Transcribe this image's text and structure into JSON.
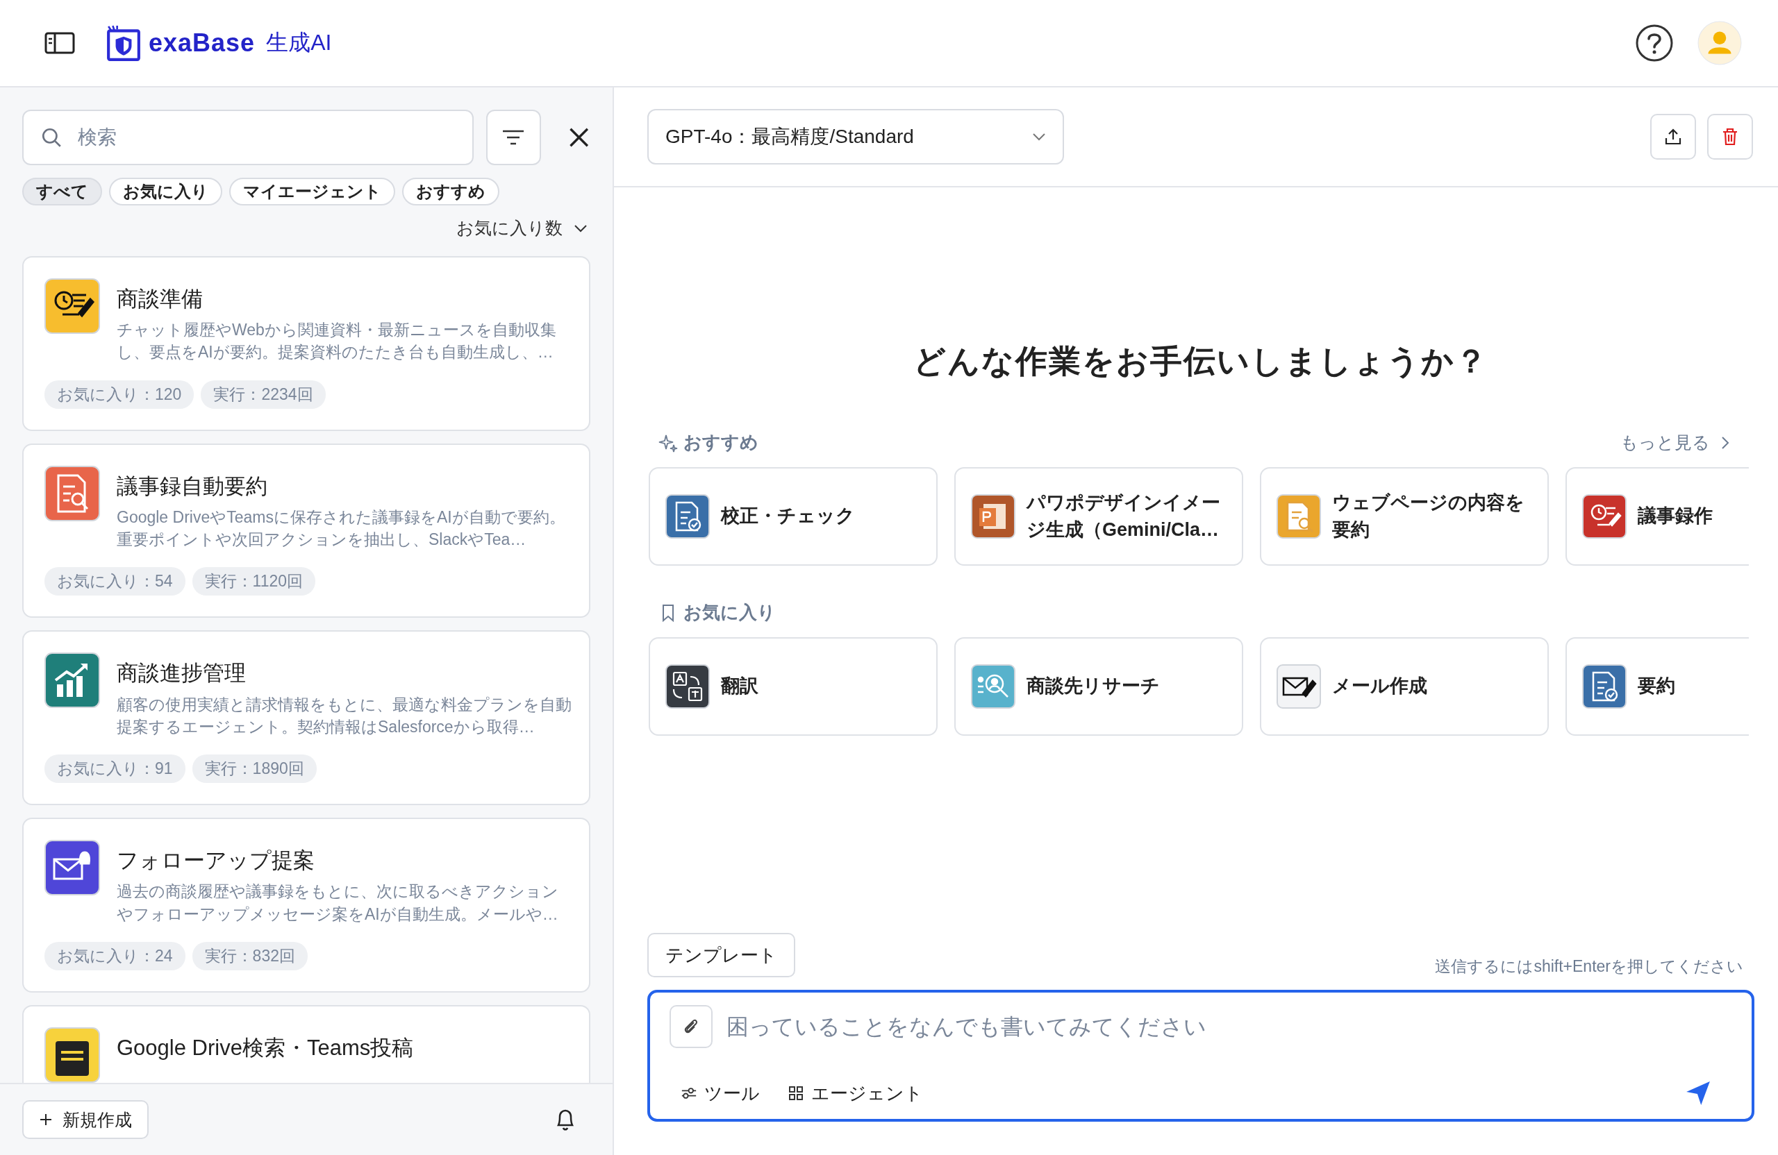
{
  "header": {
    "logo_text": "exaBase",
    "logo_suffix": "生成AI"
  },
  "sidebar": {
    "search": {
      "placeholder": "検索"
    },
    "filters": [
      {
        "label": "すべて",
        "selected": true
      },
      {
        "label": "お気に入り",
        "selected": false
      },
      {
        "label": "マイエージェント",
        "selected": false
      },
      {
        "label": "おすすめ",
        "selected": false
      }
    ],
    "sort": "お気に入り数",
    "agents": [
      {
        "title": "商談準備",
        "description": "チャット履歴やWebから関連資料・最新ニュースを自動収集し、要点をAIが要約。提案資料のたたき台も自動生成し、…",
        "favorites": "お気に入り：120",
        "runs": "実行：2234回",
        "color": "#f7bd2e",
        "kind": "schedule"
      },
      {
        "title": "議事録自動要約",
        "description": "Google DriveやTeamsに保存された議事録をAIが自動で要約。重要ポイントや次回アクションを抽出し、SlackやTea…",
        "favorites": "お気に入り：54",
        "runs": "実行：1120回",
        "color": "#e8654a",
        "kind": "doc-search"
      },
      {
        "title": "商談進捗管理",
        "description": "顧客の使用実績と請求情報をもとに、最適な料金プランを自動提案するエージェント。契約情報はSalesforceから取得…",
        "favorites": "お気に入り：91",
        "runs": "実行：1890回",
        "color": "#1f7f7a",
        "kind": "chart"
      },
      {
        "title": "フォローアップ提案",
        "description": "過去の商談履歴や議事録をもとに、次に取るべきアクションやフォローアップメッセージ案をAIが自動生成。メールや…",
        "favorites": "お気に入り：24",
        "runs": "実行：832回",
        "color": "#4f46d8",
        "kind": "mail-bell"
      },
      {
        "title": "Google Drive検索・Teams投稿",
        "color": "#f7d23c",
        "kind": "list"
      }
    ],
    "new_button": "新規作成"
  },
  "main": {
    "model": "GPT-4o：最高精度/Standard",
    "heading": "どんな作業をお手伝いしましょうか？",
    "sections": [
      {
        "label": "おすすめ",
        "kind": "sparkle",
        "more": "もっと見る",
        "items": [
          {
            "title": "校正・チェック",
            "color": "#3a6fa8",
            "kind": "doc-check"
          },
          {
            "title": "パワポデザインイメージ生成（Gemini/Cla…",
            "color": "#b0562a",
            "kind": "slides"
          },
          {
            "title": "ウェブページの内容を要約",
            "color": "#eaa62d",
            "kind": "doc-search"
          },
          {
            "title": "議事録作",
            "color": "#c8322b",
            "kind": "schedule"
          }
        ]
      },
      {
        "label": "お気に入り",
        "kind": "bookmark",
        "items": [
          {
            "title": "翻訳",
            "color": "#363b42",
            "kind": "translate"
          },
          {
            "title": "商談先リサーチ",
            "color": "#58b2cc",
            "kind": "people-search"
          },
          {
            "title": "メール作成",
            "color": "#f3f4f6",
            "kind": "mail-pen"
          },
          {
            "title": "要約",
            "color": "#3a6fa8",
            "kind": "doc-check"
          }
        ]
      }
    ],
    "template_button": "テンプレート",
    "hint": "送信するにはshift+Enterを押してください",
    "input": {
      "placeholder": "困っていることをなんでも書いてみてください"
    },
    "tools": [
      {
        "label": "ツール",
        "kind": "sliders"
      },
      {
        "label": "エージェント",
        "kind": "grid"
      }
    ]
  }
}
